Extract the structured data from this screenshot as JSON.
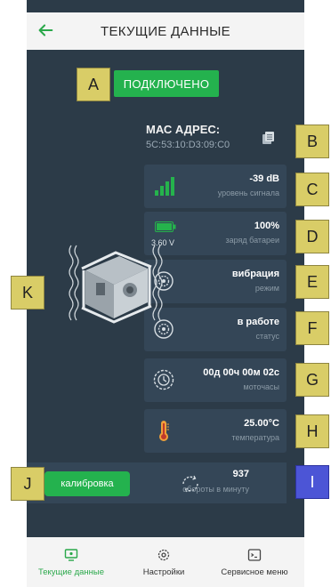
{
  "header": {
    "title": "ТЕКУЩИЕ ДАННЫЕ",
    "back_icon": "arrow-left-icon",
    "accent": "#2aa84a"
  },
  "status": {
    "label": "ПОДКЛЮЧЕНО",
    "color": "#24b24e"
  },
  "mac": {
    "title": "МАС АДРЕС:",
    "value": "5C:53:10:D3:09:C0",
    "copy_icon": "copy-icon"
  },
  "cards": {
    "signal": {
      "value": "-39 dB",
      "label": "уровень сигнала",
      "icon": "signal-bars-icon",
      "level": 4
    },
    "battery": {
      "value": "100%",
      "label": "заряд батареи",
      "voltage": "3.60 V",
      "icon": "battery-icon",
      "fill": 1.0
    },
    "vibration": {
      "value": "вибрация",
      "label": "режим",
      "icon": "gear-icon"
    },
    "state": {
      "value": "в работе",
      "label": "статус",
      "icon": "gear-icon"
    },
    "hours": {
      "value": "00д 00ч 00м 02с",
      "label": "моточасы",
      "icon": "gear-clock-icon"
    },
    "temperature": {
      "value": "25.00°C",
      "label": "температура",
      "icon": "thermometer-icon"
    }
  },
  "calibration": {
    "label": "калибровка"
  },
  "rpm": {
    "value": "937",
    "label": "обороты в минуту",
    "icon": "rotation-icon"
  },
  "badges": {
    "a": "A",
    "b": "B",
    "c": "C",
    "d": "D",
    "e": "E",
    "f": "F",
    "g": "G",
    "h": "H",
    "i": "I",
    "j": "J",
    "k": "K"
  },
  "nav": [
    {
      "label": "Текущие данные",
      "icon": "monitor-icon",
      "active": true
    },
    {
      "label": "Настройки",
      "icon": "settings-icon",
      "active": false
    },
    {
      "label": "Сервисное меню",
      "icon": "terminal-icon",
      "active": false
    }
  ]
}
